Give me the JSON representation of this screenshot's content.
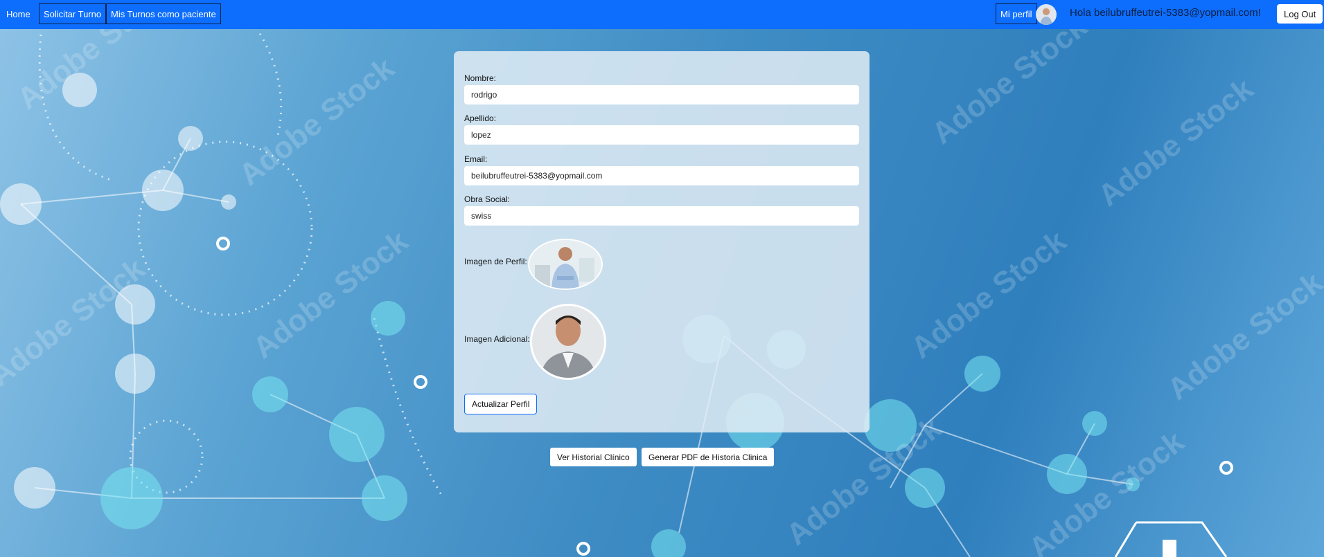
{
  "nav": {
    "home": "Home",
    "solicitar": "Solicitar Turno",
    "mis_turnos": "Mis Turnos como paciente",
    "mi_perfil": "Mi perfil",
    "greeting": "Hola beilubruffeutrei-5383@yopmail.com!",
    "logout": "Log Out",
    "avatar_icon": "user-avatar"
  },
  "background": {
    "watermark": "Adobe Stock"
  },
  "form": {
    "nombre_label": "Nombre:",
    "nombre_value": "rodrigo",
    "apellido_label": "Apellido:",
    "apellido_value": "lopez",
    "email_label": "Email:",
    "email_value": "beilubruffeutrei-5383@yopmail.com",
    "obra_label": "Obra Social:",
    "obra_value": "swiss",
    "imagen_perfil_label": "Imagen de Perfil:",
    "imagen_adicional_label": "Imagen Adicional:",
    "update_button": "Actualizar Perfil"
  },
  "actions": {
    "historial": "Ver Historial Clínico",
    "pdf": "Generar PDF de Historia Clinica"
  },
  "colors": {
    "navbar": "#0d6efd",
    "accent_border": "#0d6efd"
  }
}
